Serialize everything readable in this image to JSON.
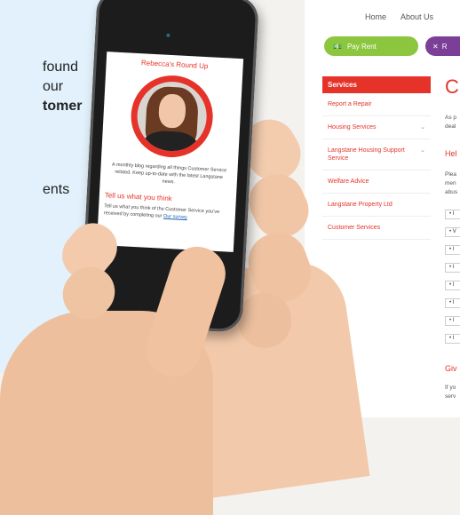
{
  "left_panel": {
    "lines": [
      "found",
      "our",
      "tomer",
      "ents"
    ]
  },
  "site": {
    "nav": [
      "Home",
      "About Us"
    ],
    "pay_rent": "Pay Rent",
    "repair_label": "R",
    "sidebar_header": "Services",
    "sidebar_items": [
      {
        "label": "Report a Repair",
        "chevron": false
      },
      {
        "label": "Housing Services",
        "chevron": true
      },
      {
        "label": "Langstane Housing Support Service",
        "chevron": true
      },
      {
        "label": "Welfare Advice",
        "chevron": false
      },
      {
        "label": "Langstane Property Ltd",
        "chevron": false
      },
      {
        "label": "Customer Services",
        "chevron": false
      }
    ],
    "main_title": "C",
    "intro_lines": [
      "As p",
      "deal"
    ],
    "sub1": "Hel",
    "para_lines": [
      "Plea",
      "men",
      "abus"
    ],
    "list_items": [
      "• I",
      "• V",
      "• I",
      "• I",
      "• I",
      "• I",
      "• I",
      "• I"
    ],
    "sub2": "Giv",
    "foot_lines": [
      "If yo",
      "serv"
    ]
  },
  "phone_screen": {
    "title": "Rebecca's Round Up",
    "description": "A monthly blog regarding all things Customer Service related. Keep up-to-date with the latest Langstane news.",
    "subheading": "Tell us what you think",
    "body": "Tell us what you think of the Customer Service you've received by completing our",
    "link": "Our survey"
  },
  "colors": {
    "brand_red": "#e5332a",
    "pay_green": "#8cc63e",
    "repair_purple": "#7b3f98",
    "panel_blue": "#e2f1fb"
  }
}
